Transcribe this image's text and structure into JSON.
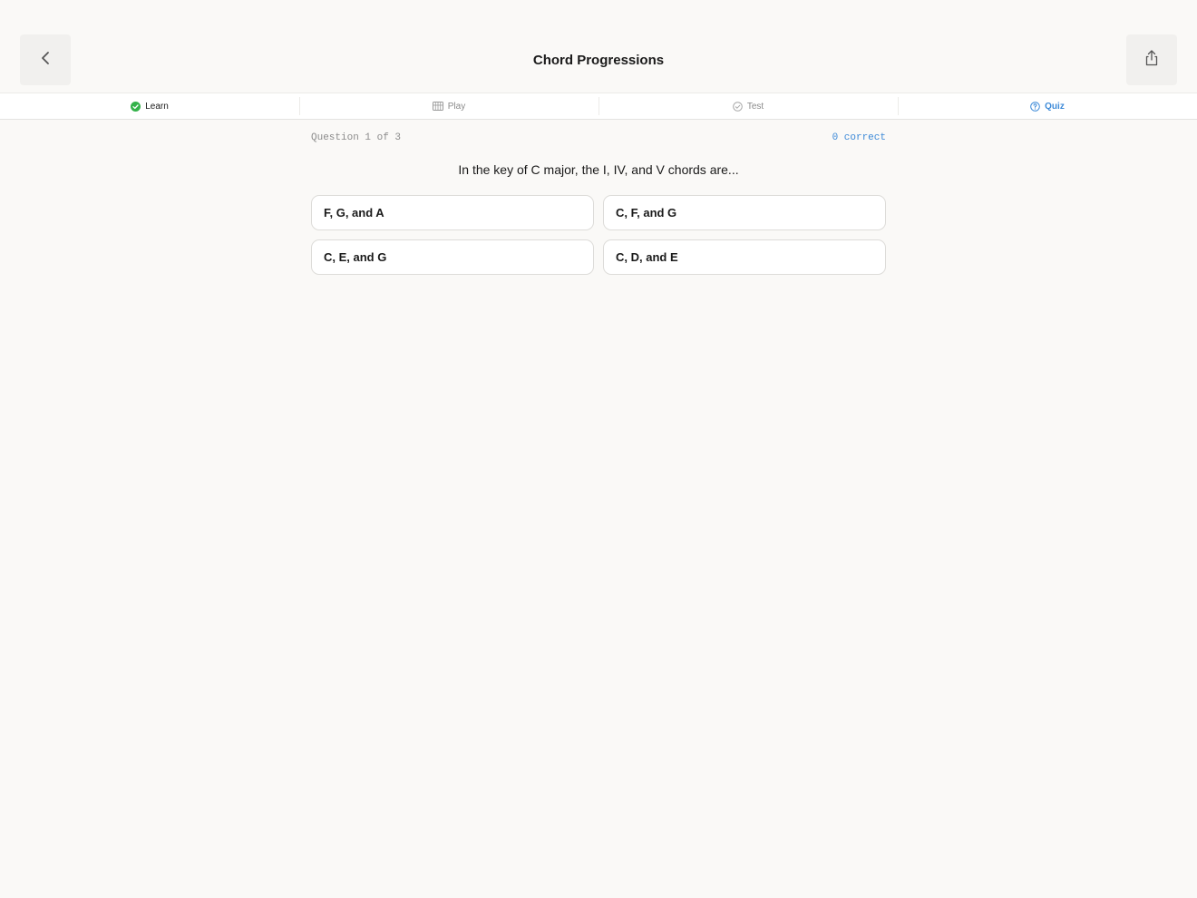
{
  "header": {
    "title": "Chord Progressions",
    "back_icon": "chevron-left-icon",
    "share_icon": "share-icon"
  },
  "tabs": [
    {
      "label": "Learn",
      "icon": "check-circle-icon",
      "state": "completed"
    },
    {
      "label": "Play",
      "icon": "piano-keys-icon",
      "state": "inactive"
    },
    {
      "label": "Test",
      "icon": "check-circle-outline-icon",
      "state": "inactive"
    },
    {
      "label": "Quiz",
      "icon": "question-circle-icon",
      "state": "active"
    }
  ],
  "quiz": {
    "progress": "Question 1 of 3",
    "score": "0 correct",
    "question": "In the key of C major, the I, IV, and V chords are...",
    "answers": [
      "F, G, and A",
      "C, F, and G",
      "C, E, and G",
      "C, D, and E"
    ]
  },
  "colors": {
    "background": "#faf9f7",
    "accent": "#3d8ad8",
    "success": "#34b24a"
  }
}
